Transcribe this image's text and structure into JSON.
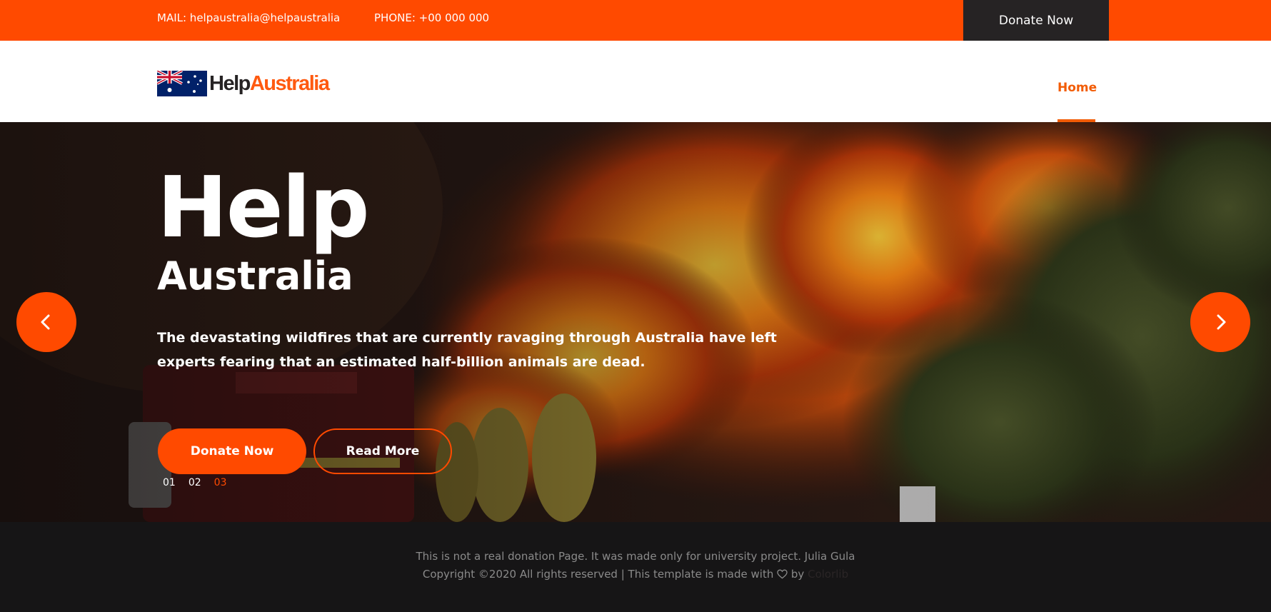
{
  "topbar": {
    "mail": "MAIL: helpaustralia@helpaustralia",
    "phone": "PHONE: +00 000 000",
    "donate_label": "Donate Now"
  },
  "logo": {
    "brand_part1": "Help",
    "brand_part2": "Australia"
  },
  "nav": {
    "items": [
      {
        "label": "Home",
        "active": true
      }
    ]
  },
  "hero": {
    "title": "Help",
    "subtitle": "Australia",
    "description": "The devastating wildfires that are currently ravaging through Australia have left experts fearing that an estimated half-billion animals are dead.",
    "donate_label": "Donate Now",
    "read_more_label": "Read More",
    "slides": [
      "01",
      "02",
      "03"
    ],
    "active_slide": "03"
  },
  "footer": {
    "line1": "This is not a real donation Page. It was made only for university project. Julia Gula",
    "line2_prefix": "Copyright ©2020 All rights reserved | This template is made with",
    "line2_by": "by",
    "credit": "Colorlib"
  },
  "colors": {
    "accent": "#ff4a00",
    "nav_active": "#f25c05",
    "dark": "#262324",
    "footer_bg": "#161516"
  }
}
